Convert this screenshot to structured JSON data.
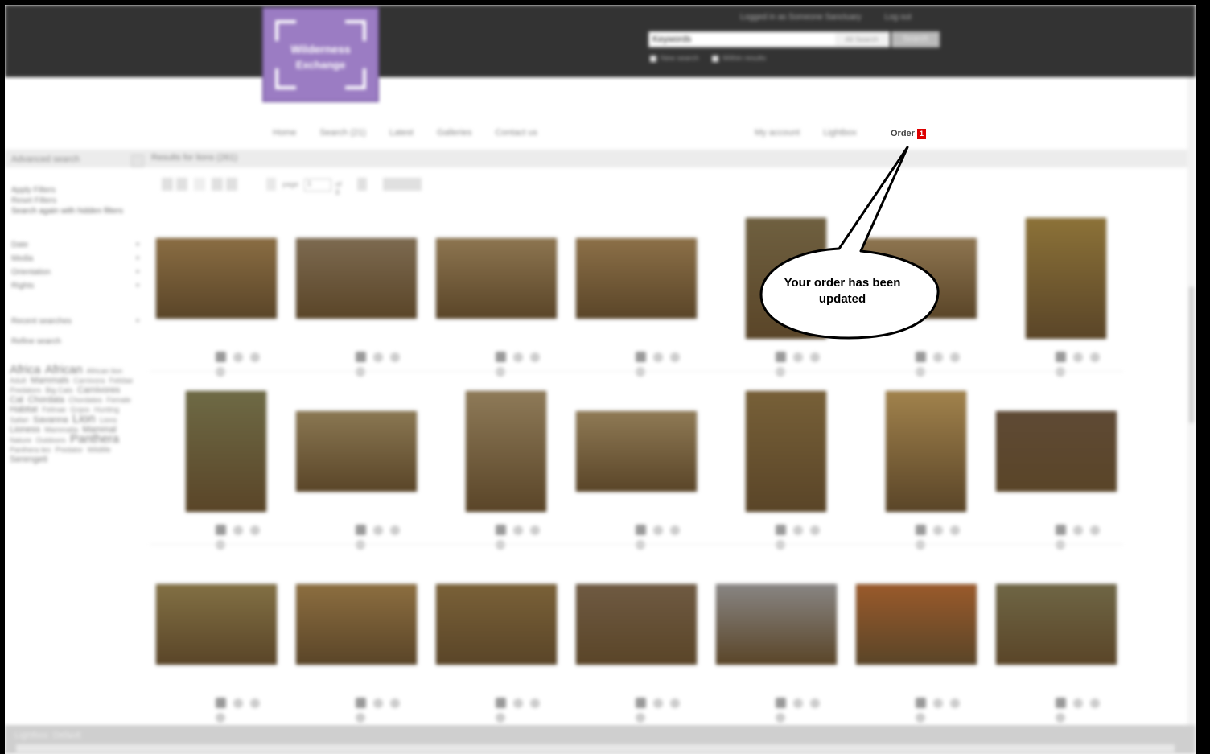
{
  "header": {
    "logo_line1": "Wilderness",
    "logo_line2": "Exchange",
    "top_links": [
      "Logged in as Someone Sanctuary",
      "Log out"
    ],
    "search": {
      "value": "Keywords",
      "select": "All Search",
      "button": "Search",
      "options": [
        "New search",
        "Within results"
      ]
    }
  },
  "nav": {
    "left": [
      "Home",
      "Search (21)",
      "Latest",
      "Galleries",
      "Contact us"
    ],
    "right": [
      "My account",
      "Lightbox"
    ],
    "order_label": "Order",
    "order_count": "1"
  },
  "results_title": "Results for lions (261)",
  "sidebar": {
    "title": "Advanced search",
    "filter_links": [
      "Apply Filters",
      "Reset Filters",
      "Search again with hidden filters"
    ],
    "filters": [
      "Date",
      "Media",
      "Orientation",
      "Rights"
    ],
    "recent": "Recent searches",
    "saved": "Refine search",
    "cloud": [
      {
        "t": "Africa",
        "s": "big"
      },
      {
        "t": "African",
        "s": "big"
      },
      {
        "t": "African lion",
        "s": ""
      },
      {
        "t": "Adult",
        "s": ""
      },
      {
        "t": "Mammals",
        "s": "med"
      },
      {
        "t": "Carnivora",
        "s": ""
      },
      {
        "t": "Felidae",
        "s": ""
      },
      {
        "t": "Predators",
        "s": ""
      },
      {
        "t": "Big Cats",
        "s": ""
      },
      {
        "t": "Carnivores",
        "s": "med"
      },
      {
        "t": "Cat",
        "s": "med"
      },
      {
        "t": "Chordata",
        "s": "med"
      },
      {
        "t": "Chordates",
        "s": ""
      },
      {
        "t": "Female",
        "s": ""
      },
      {
        "t": "Habitat",
        "s": "med"
      },
      {
        "t": "Felinae",
        "s": ""
      },
      {
        "t": "Grass",
        "s": ""
      },
      {
        "t": "Hunting",
        "s": ""
      },
      {
        "t": "Safari",
        "s": ""
      },
      {
        "t": "Savanna",
        "s": "med"
      },
      {
        "t": "Lion",
        "s": "big"
      },
      {
        "t": "Lions",
        "s": ""
      },
      {
        "t": "Lioness",
        "s": "med"
      },
      {
        "t": "Mammalia",
        "s": ""
      },
      {
        "t": "Mammal",
        "s": "med"
      },
      {
        "t": "Nature",
        "s": ""
      },
      {
        "t": "Outdoors",
        "s": ""
      },
      {
        "t": "Panthera",
        "s": "big"
      },
      {
        "t": "Panthera leo",
        "s": ""
      },
      {
        "t": "Predator",
        "s": ""
      },
      {
        "t": "Wildlife",
        "s": ""
      },
      {
        "t": "Serengeti",
        "s": "med"
      }
    ]
  },
  "toolbar": {
    "page_label": "page",
    "page_value": "1",
    "of_label": "of 8"
  },
  "thumbnails": [
    {
      "c": "#8a6d43"
    },
    {
      "c": "#7d6a50"
    },
    {
      "c": "#8d7550"
    },
    {
      "c": "#8c7048"
    },
    {
      "c": "#6f6040",
      "tall": true
    },
    {
      "c": "#8e7550"
    },
    {
      "c": "#8c7238",
      "tall": true
    },
    {
      "c": "#6e6a45",
      "tall": true
    },
    {
      "c": "#8a7752"
    },
    {
      "c": "#8e7a58",
      "tall": true
    },
    {
      "c": "#8f7a55"
    },
    {
      "c": "#776038",
      "tall": true
    },
    {
      "c": "#a1824c",
      "tall": true
    },
    {
      "c": "#5f4a35"
    },
    {
      "c": "#827044"
    },
    {
      "c": "#8c6e40"
    },
    {
      "c": "#7a6138"
    },
    {
      "c": "#6f5a42"
    },
    {
      "c": "#888583"
    },
    {
      "c": "#9a5a2b"
    },
    {
      "c": "#6f6645"
    }
  ],
  "bottom": {
    "label": "Lightbox: Default"
  },
  "callout": {
    "text": "Your order has been updated"
  }
}
